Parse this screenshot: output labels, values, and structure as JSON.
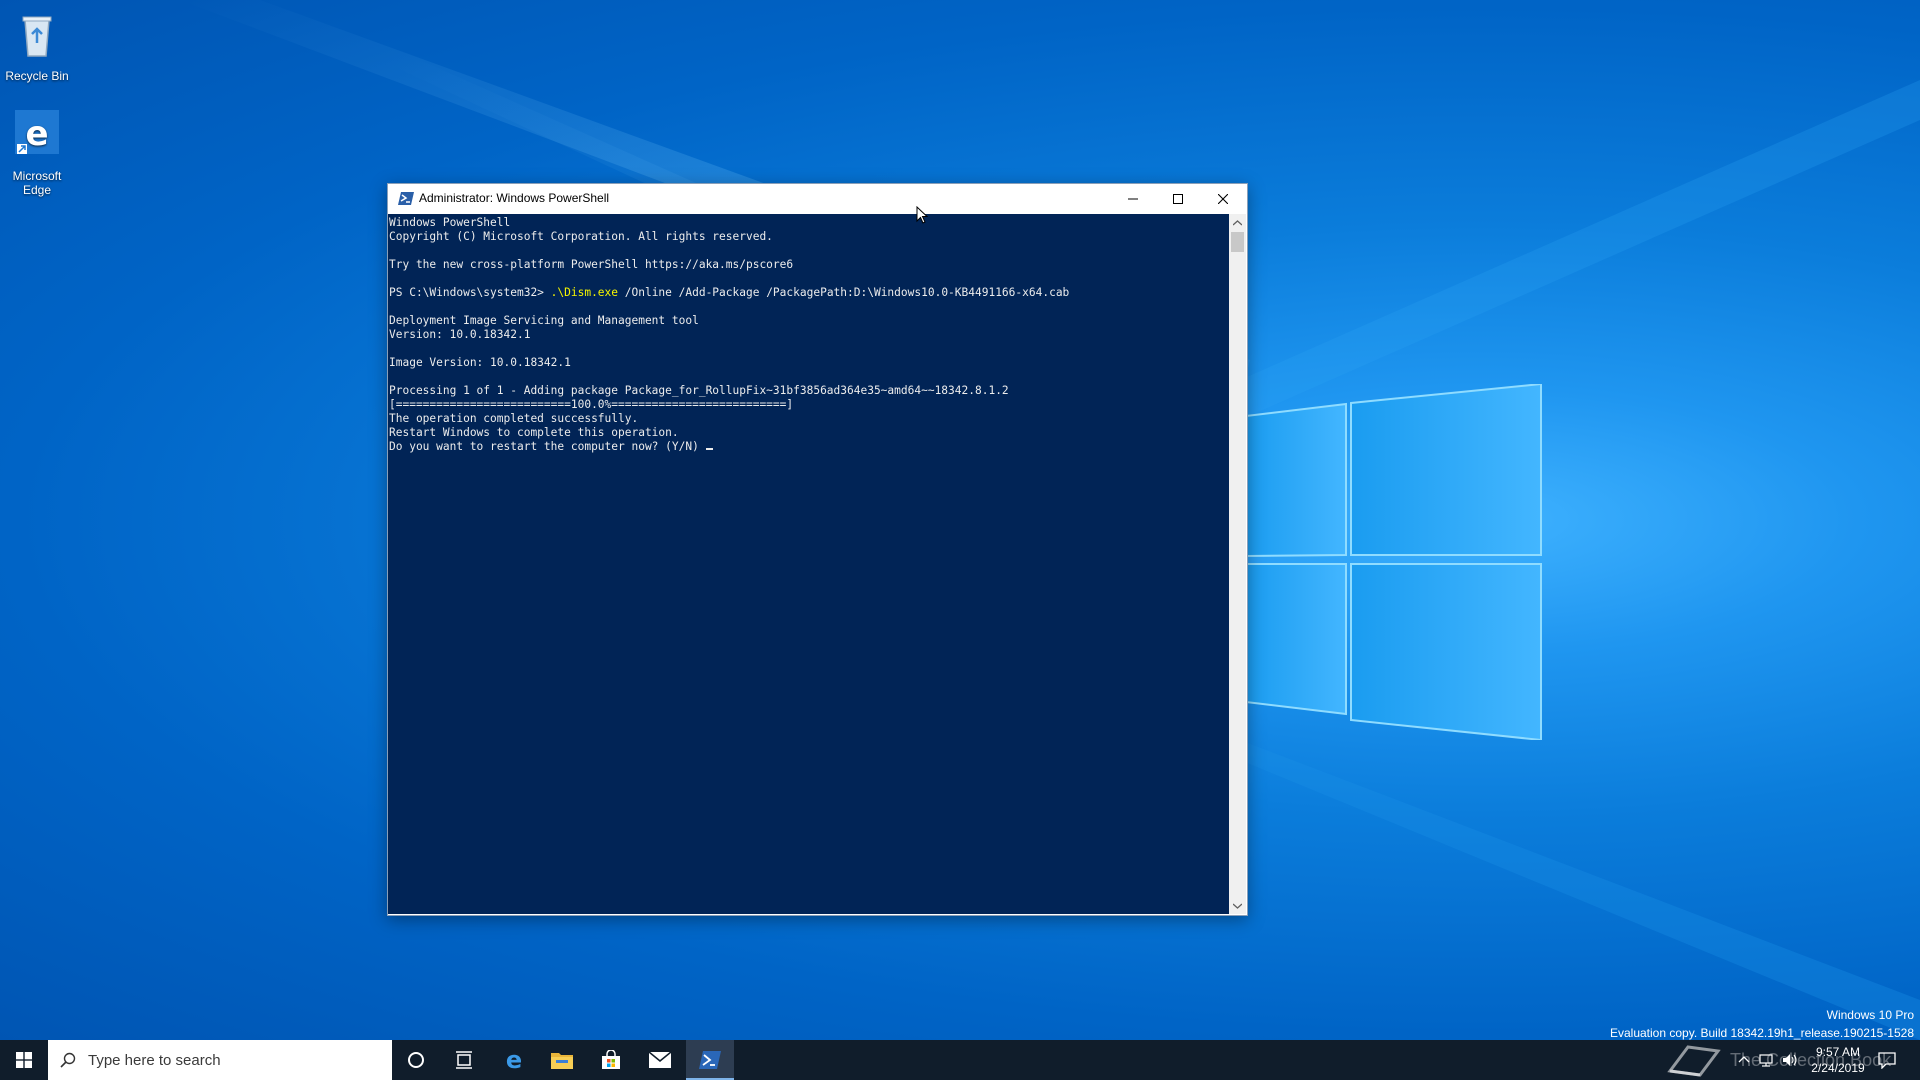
{
  "desktop": {
    "icons": [
      {
        "label": "Recycle Bin"
      },
      {
        "label": "Microsoft\nEdge"
      }
    ]
  },
  "window": {
    "title": "Administrator: Windows PowerShell",
    "console": {
      "banner_1": "Windows PowerShell",
      "banner_2": "Copyright (C) Microsoft Corporation. All rights reserved.",
      "try_line": "Try the new cross-platform PowerShell https://aka.ms/pscore6",
      "prompt": "PS C:\\Windows\\system32> ",
      "command_exe": ".\\Dism.exe",
      "command_args": " /Online /Add-Package /PackagePath:D:\\Windows10.0-KB4491166-x64.cab",
      "dism_name": "Deployment Image Servicing and Management tool",
      "dism_version": "Version: 10.0.18342.1",
      "image_version": "Image Version: 10.0.18342.1",
      "processing": "Processing 1 of 1 - Adding package Package_for_RollupFix~31bf3856ad364e35~amd64~~18342.8.1.2",
      "progress_bar": "[==========================100.0%==========================]",
      "success": "The operation completed successfully.",
      "restart_note": "Restart Windows to complete this operation.",
      "restart_prompt": "Do you want to restart the computer now? (Y/N) "
    }
  },
  "watermark": {
    "edition": "Windows 10 Pro",
    "build": "Evaluation copy. Build 18342.19h1_release.190215-1528"
  },
  "taskbar": {
    "search_placeholder": "Type here to search",
    "apps": [
      "cortana-icon",
      "task-view-icon",
      "edge-icon",
      "file-explorer-icon",
      "store-icon",
      "mail-icon",
      "powershell-icon"
    ],
    "brand_overlay": "The Collection Book",
    "clock_time": "9:57 AM",
    "clock_date": "2/24/2019"
  },
  "colors": {
    "console_bg": "#012456",
    "console_fg": "#ececec",
    "command_highlight": "#f5f500",
    "taskbar_bg": "#101d2b"
  }
}
